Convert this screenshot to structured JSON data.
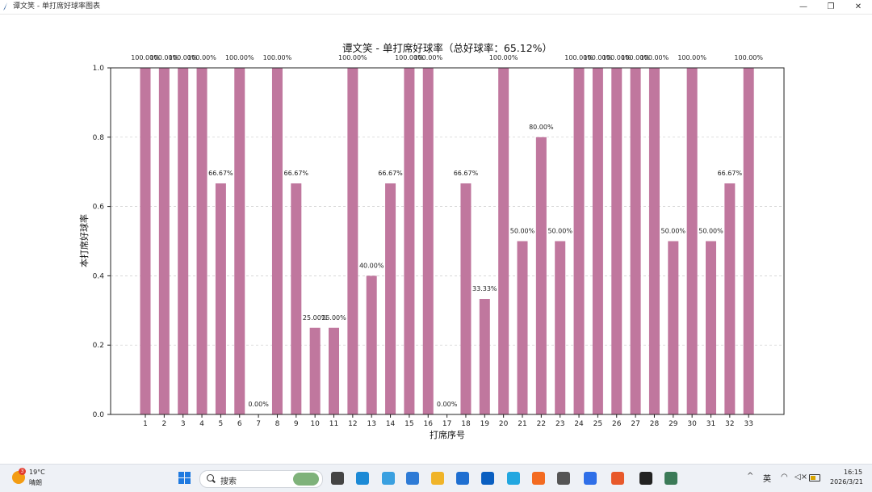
{
  "window": {
    "title": "谭文笑 - 单打席好球率图表",
    "min_glyph": "—",
    "max_glyph": "❐",
    "close_glyph": "✕"
  },
  "chart_data": {
    "type": "bar",
    "title": "谭文笑 - 单打席好球率（总好球率：65.12%）",
    "xlabel": "打席序号",
    "ylabel": "本打席好球率",
    "categories": [
      "1",
      "2",
      "3",
      "4",
      "5",
      "6",
      "7",
      "8",
      "9",
      "10",
      "11",
      "12",
      "13",
      "14",
      "15",
      "16",
      "17",
      "18",
      "19",
      "20",
      "21",
      "22",
      "23",
      "24",
      "25",
      "26",
      "27",
      "28",
      "29",
      "30",
      "31",
      "32",
      "33"
    ],
    "values": [
      1.0,
      1.0,
      1.0,
      1.0,
      0.6667,
      1.0,
      0.0,
      1.0,
      0.6667,
      0.25,
      0.25,
      1.0,
      0.4,
      0.6667,
      1.0,
      1.0,
      0.0,
      0.6667,
      0.3333,
      1.0,
      0.5,
      0.8,
      0.5,
      1.0,
      1.0,
      1.0,
      1.0,
      1.0,
      0.5,
      1.0,
      0.5,
      0.6667,
      1.0
    ],
    "data_labels": [
      "100.00%",
      "100.00%",
      "100.00%",
      "100.00%",
      "66.67%",
      "100.00%",
      "0.00%",
      "100.00%",
      "66.67%",
      "25.00%",
      "25.00%",
      "100.00%",
      "40.00%",
      "66.67%",
      "100.00%",
      "100.00%",
      "0.00%",
      "66.67%",
      "33.33%",
      "100.00%",
      "50.00%",
      "80.00%",
      "50.00%",
      "100.00%",
      "100.00%",
      "100.00%",
      "100.00%",
      "100.00%",
      "50.00%",
      "100.00%",
      "50.00%",
      "66.67%",
      "100.00%"
    ],
    "yticks": [
      "0.0",
      "0.2",
      "0.4",
      "0.6",
      "0.8",
      "1.0"
    ],
    "ylim": [
      0,
      1
    ],
    "grid": "horizontal-dashed",
    "bar_color": "#c0779e"
  },
  "taskbar": {
    "weather": {
      "badge": "3",
      "temp": "19°C",
      "desc": "晴朗"
    },
    "search_placeholder": "搜索",
    "icons": [
      {
        "name": "start-icon"
      },
      {
        "name": "task-view-icon",
        "color": "#444444"
      },
      {
        "name": "edge-icon",
        "color": "#1c8ad6"
      },
      {
        "name": "edge-beta-icon",
        "color": "#3aa0e0"
      },
      {
        "name": "store-app-icon",
        "color": "#2e7bd6"
      },
      {
        "name": "file-explorer-icon",
        "color": "#f0b429"
      },
      {
        "name": "microsoft-store-icon",
        "color": "#1f6fd1"
      },
      {
        "name": "hp-icon",
        "color": "#0a5fc1"
      },
      {
        "name": "bilibili-icon",
        "color": "#22a7e0"
      },
      {
        "name": "taobao-icon",
        "color": "#f36b21"
      },
      {
        "name": "app-grey-icon",
        "color": "#555555"
      },
      {
        "name": "chat-app-icon",
        "color": "#2f6fe8"
      },
      {
        "name": "firefox-icon",
        "color": "#e8592b"
      },
      {
        "name": "terminal-icon",
        "color": "#222222"
      },
      {
        "name": "remote-app-icon",
        "color": "#3b7a57"
      }
    ],
    "tray": {
      "chevron": "^",
      "ime": "英",
      "wifi": "◠",
      "volume": "◁×"
    },
    "clock": {
      "time": "16:15",
      "date": "2026/3/21"
    }
  }
}
